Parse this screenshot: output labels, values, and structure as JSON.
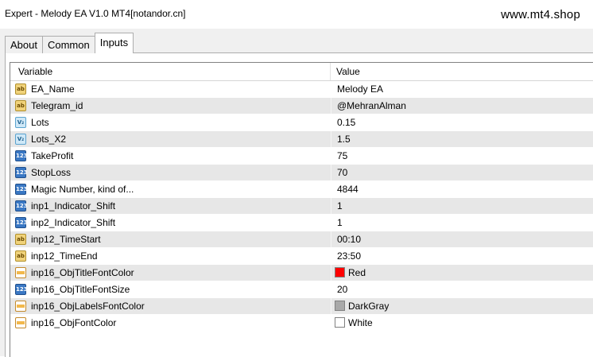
{
  "window": {
    "title": "Expert - Melody EA V1.0 MT4[notandor.cn]",
    "watermark": "www.mt4.shop"
  },
  "tabs": [
    {
      "label": "About",
      "active": false
    },
    {
      "label": "Common",
      "active": false
    },
    {
      "label": "Inputs",
      "active": true
    }
  ],
  "table": {
    "headers": {
      "variable": "Variable",
      "value": "Value"
    },
    "rows": [
      {
        "name": "EA_Name",
        "value": "Melody EA",
        "type": "string",
        "icon": "string-icon"
      },
      {
        "name": "Telegram_id",
        "value": "@MehranAlman",
        "type": "string",
        "icon": "string-icon"
      },
      {
        "name": "Lots",
        "value": "0.15",
        "type": "double",
        "icon": "double-icon"
      },
      {
        "name": "Lots_X2",
        "value": "1.5",
        "type": "double",
        "icon": "double-icon"
      },
      {
        "name": "TakeProfit",
        "value": "75",
        "type": "int",
        "icon": "integer-icon"
      },
      {
        "name": "StopLoss",
        "value": "70",
        "type": "int",
        "icon": "integer-icon"
      },
      {
        "name": "Magic Number, kind of...",
        "value": "4844",
        "type": "int",
        "icon": "integer-icon"
      },
      {
        "name": "inp1_Indicator_Shift",
        "value": "1",
        "type": "int",
        "icon": "integer-icon"
      },
      {
        "name": "inp2_Indicator_Shift",
        "value": "1",
        "type": "int",
        "icon": "integer-icon"
      },
      {
        "name": "inp12_TimeStart",
        "value": "00:10",
        "type": "string",
        "icon": "string-icon"
      },
      {
        "name": "inp12_TimeEnd",
        "value": "23:50",
        "type": "string",
        "icon": "string-icon"
      },
      {
        "name": "inp16_ObjTitleFontColor",
        "value": "Red",
        "type": "color",
        "icon": "color-icon",
        "swatch": "#ff0000"
      },
      {
        "name": "inp16_ObjTitleFontSize",
        "value": "20",
        "type": "int",
        "icon": "integer-icon"
      },
      {
        "name": "inp16_ObjLabelsFontColor",
        "value": "DarkGray",
        "type": "color",
        "icon": "color-icon",
        "swatch": "#a9a9a9"
      },
      {
        "name": "inp16_ObjFontColor",
        "value": "White",
        "type": "color",
        "icon": "color-icon",
        "swatch": "#ffffff"
      }
    ]
  }
}
